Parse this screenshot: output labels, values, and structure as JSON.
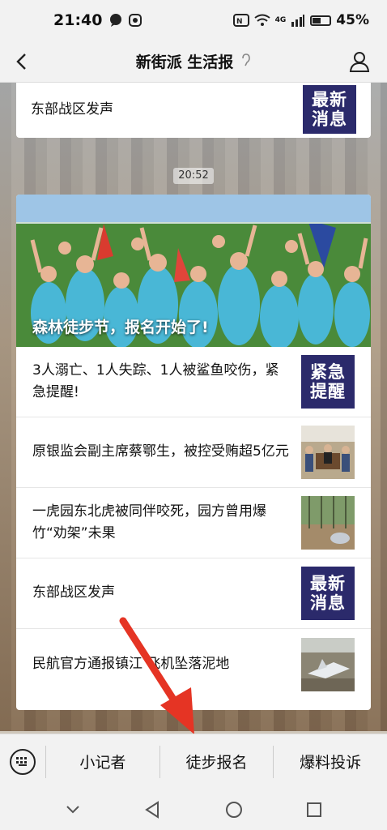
{
  "status_bar": {
    "time": "21:40",
    "signal": "4G",
    "battery": "45%"
  },
  "header": {
    "title": "新街派 生活报"
  },
  "chat": {
    "top_card": {
      "text": "东部战区发声",
      "tag_line1": "最新",
      "tag_line2": "消息"
    },
    "timestamp": "20:52",
    "main_card": {
      "hero_caption": "森林徒步节，报名开始了!",
      "items": [
        {
          "text": "3人溺亡、1人失踪、1人被鲨鱼咬伤，紧急提醒!",
          "tag_line1": "紧急",
          "tag_line2": "提醒",
          "thumb": "tag"
        },
        {
          "text": "原银监会副主席蔡鄂生，被控受贿超5亿元",
          "thumb": "court-photo"
        },
        {
          "text": "一虎园东北虎被同伴咬死，园方曾用爆竹“劝架”未果",
          "thumb": "tiger-photo"
        },
        {
          "text": "东部战区发声",
          "tag_line1": "最新",
          "tag_line2": "消息",
          "thumb": "tag"
        },
        {
          "text": "民航官方通报镇江   飞机坠落泥地",
          "thumb": "plane-photo"
        }
      ]
    }
  },
  "menu": {
    "items": [
      "小记者",
      "徒步报名",
      "爆料投诉"
    ]
  },
  "colors": {
    "tag_bg": "#2b2a6b",
    "arrow": "#e53424"
  }
}
